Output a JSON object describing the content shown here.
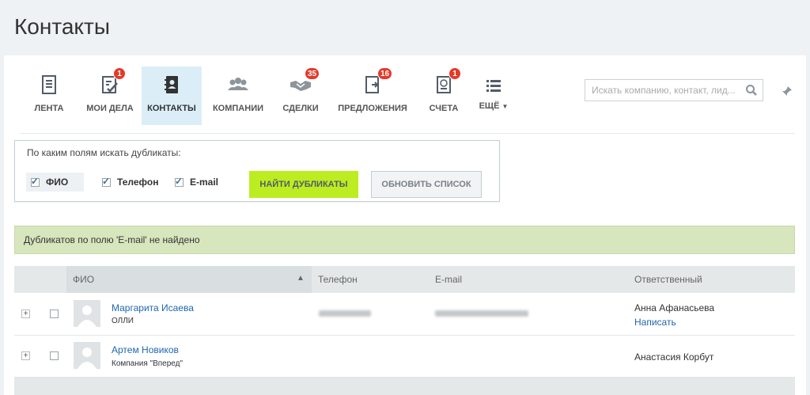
{
  "page": {
    "title": "Контакты"
  },
  "nav": {
    "items": [
      {
        "label": "ЛЕНТА",
        "badge": ""
      },
      {
        "label": "МОИ ДЕЛА",
        "badge": "1"
      },
      {
        "label": "КОНТАКТЫ",
        "badge": ""
      },
      {
        "label": "КОМПАНИИ",
        "badge": ""
      },
      {
        "label": "СДЕЛКИ",
        "badge": "35"
      },
      {
        "label": "ПРЕДЛОЖЕНИЯ",
        "badge": "16"
      },
      {
        "label": "СЧЕТА",
        "badge": "1"
      },
      {
        "label": "ЕЩЁ",
        "badge": ""
      }
    ],
    "active": "КОНТАКТЫ"
  },
  "search": {
    "placeholder": "Искать компанию, контакт, лид..."
  },
  "duplicates": {
    "title": "По каким полям искать дубликаты:",
    "fields": [
      {
        "label": "ФИО",
        "checked": true
      },
      {
        "label": "Телефон",
        "checked": true
      },
      {
        "label": "E-mail",
        "checked": true
      }
    ],
    "find_label": "НАЙТИ ДУБЛИКАТЫ",
    "refresh_label": "ОБНОВИТЬ СПИСОК"
  },
  "notice": "Дубликатов по полю 'E-mail' не найдено",
  "grid": {
    "columns": {
      "name": "ФИО",
      "phone": "Телефон",
      "email": "E-mail",
      "responsible": "Ответственный"
    },
    "rows": [
      {
        "name": "Маргарита Исаева",
        "company": "ОЛЛИ",
        "phone_hidden": true,
        "email_hidden": true,
        "responsible": "Анна Афанасьева",
        "action": "Написать"
      },
      {
        "name": "Артем Новиков",
        "company": "Компания \"Вперед\"",
        "phone_hidden": false,
        "email_hidden": false,
        "responsible": "Анастасия Корбут",
        "action": ""
      }
    ]
  },
  "colors": {
    "accent": "#bbed21",
    "link": "#2067b0",
    "badge": "#e33b2a",
    "notice_bg": "#d7e6bd",
    "active_tab": "#dbeef8"
  }
}
